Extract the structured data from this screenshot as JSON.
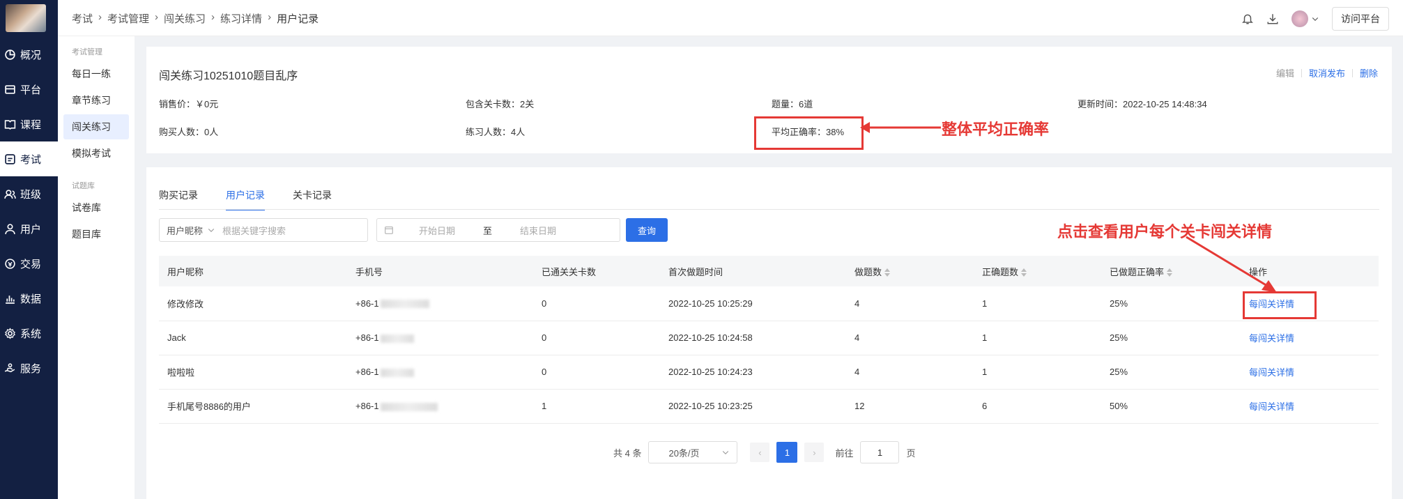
{
  "nav": [
    {
      "label": "概况",
      "icon": "overview-icon"
    },
    {
      "label": "平台",
      "icon": "platform-icon"
    },
    {
      "label": "课程",
      "icon": "book-icon"
    },
    {
      "label": "考试",
      "icon": "exam-icon",
      "active": true
    },
    {
      "label": "班级",
      "icon": "class-icon"
    },
    {
      "label": "用户",
      "icon": "user-icon"
    },
    {
      "label": "交易",
      "icon": "trade-icon"
    },
    {
      "label": "数据",
      "icon": "chart-icon"
    },
    {
      "label": "系统",
      "icon": "gear-icon"
    },
    {
      "label": "服务",
      "icon": "service-icon"
    }
  ],
  "subnav": {
    "group1": "考试管理",
    "items1": [
      "每日一练",
      "章节练习",
      "闯关练习",
      "模拟考试"
    ],
    "group2": "试题库",
    "items2": [
      "试卷库",
      "题目库"
    ]
  },
  "breadcrumb": [
    "考试",
    "考试管理",
    "闯关练习",
    "练习详情",
    "用户记录"
  ],
  "topbar": {
    "visit": "访问平台"
  },
  "detail": {
    "title": "闯关练习10251010题目乱序",
    "actions": [
      "编辑",
      "取消发布",
      "删除"
    ],
    "price": "销售价：￥0元",
    "levels": "包含关卡数：2关",
    "questions": "题量：6道",
    "updated": "更新时间：2022-10-25 14:48:34",
    "buyers": "购买人数：0人",
    "practicers": "练习人数：4人",
    "accuracy": "平均正确率：38%"
  },
  "annotations": {
    "avg": "整体平均正确率",
    "click": "点击查看用户每个关卡闯关详情"
  },
  "tabs": [
    "购买记录",
    "用户记录",
    "关卡记录"
  ],
  "filters": {
    "select": "用户昵称",
    "placeholder": "根据关键字搜索",
    "start": "开始日期",
    "to": "至",
    "end": "结束日期",
    "query": "查询"
  },
  "table": {
    "headers": [
      "用户昵称",
      "手机号",
      "已通关关卡数",
      "首次做题时间",
      "做题数",
      "正确题数",
      "已做题正确率",
      "操作"
    ],
    "rows": [
      {
        "name": "修改修改",
        "phone": "+86-1",
        "passed": "0",
        "time": "2022-10-25 10:25:29",
        "done": "4",
        "correct": "1",
        "rate": "25%",
        "op": "每闯关详情"
      },
      {
        "name": "Jack",
        "phone": "+86-1",
        "passed": "0",
        "time": "2022-10-25 10:24:58",
        "done": "4",
        "correct": "1",
        "rate": "25%",
        "op": "每闯关详情"
      },
      {
        "name": "啦啦啦",
        "phone": "+86-1",
        "passed": "0",
        "time": "2022-10-25 10:24:23",
        "done": "4",
        "correct": "1",
        "rate": "25%",
        "op": "每闯关详情"
      },
      {
        "name": "手机尾号8886的用户",
        "phone": "+86-1",
        "passed": "1",
        "time": "2022-10-25 10:23:25",
        "done": "12",
        "correct": "6",
        "rate": "50%",
        "op": "每闯关详情"
      }
    ]
  },
  "pager": {
    "total": "共 4 条",
    "size": "20条/页",
    "current": "1",
    "goto": "前往",
    "page_input": "1",
    "page_unit": "页"
  }
}
